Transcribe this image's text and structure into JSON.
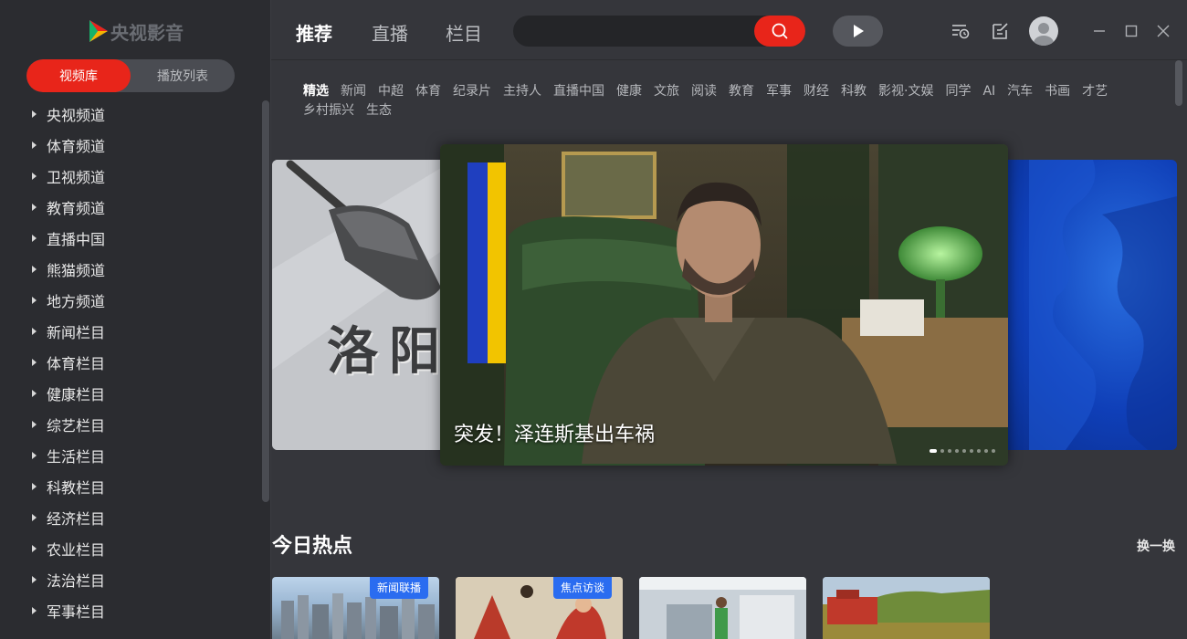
{
  "app": {
    "logo_text": "央视影音"
  },
  "sidebar": {
    "tabs": [
      {
        "label": "视频库",
        "active": true
      },
      {
        "label": "播放列表",
        "active": false
      }
    ],
    "items": [
      {
        "label": "央视频道"
      },
      {
        "label": "体育频道"
      },
      {
        "label": "卫视频道"
      },
      {
        "label": "教育频道"
      },
      {
        "label": "直播中国"
      },
      {
        "label": "熊猫频道"
      },
      {
        "label": "地方频道"
      },
      {
        "label": "新闻栏目"
      },
      {
        "label": "体育栏目"
      },
      {
        "label": "健康栏目"
      },
      {
        "label": "综艺栏目"
      },
      {
        "label": "生活栏目"
      },
      {
        "label": "科教栏目"
      },
      {
        "label": "经济栏目"
      },
      {
        "label": "农业栏目"
      },
      {
        "label": "法治栏目"
      },
      {
        "label": "军事栏目"
      }
    ]
  },
  "header": {
    "tabs": [
      {
        "label": "推荐",
        "active": true
      },
      {
        "label": "直播",
        "active": false
      },
      {
        "label": "栏目",
        "active": false
      }
    ],
    "search": {
      "value": "",
      "placeholder": ""
    }
  },
  "categories": [
    "精选",
    "新闻",
    "中超",
    "体育",
    "纪录片",
    "主持人",
    "直播中国",
    "健康",
    "文旅",
    "阅读",
    "教育",
    "军事",
    "财经",
    "科教",
    "影视·文娱",
    "同学",
    "AI",
    "汽车",
    "书画",
    "才艺",
    "乡村振兴",
    "生态"
  ],
  "carousel": {
    "main_caption": "突发！泽连斯基出车祸",
    "left_caption": "洛阳",
    "slide_count": 9,
    "active_index": 0
  },
  "hot": {
    "title": "今日热点",
    "refresh": "换一换",
    "items": [
      {
        "tag": "新闻联播"
      },
      {
        "tag": "焦点访谈"
      },
      {
        "tag": ""
      },
      {
        "tag": ""
      }
    ]
  },
  "colors": {
    "accent": "#e8251a",
    "tag_blue": "#2a6cf0",
    "bg_main": "#35363b",
    "bg_sidebar": "#2b2c30"
  }
}
